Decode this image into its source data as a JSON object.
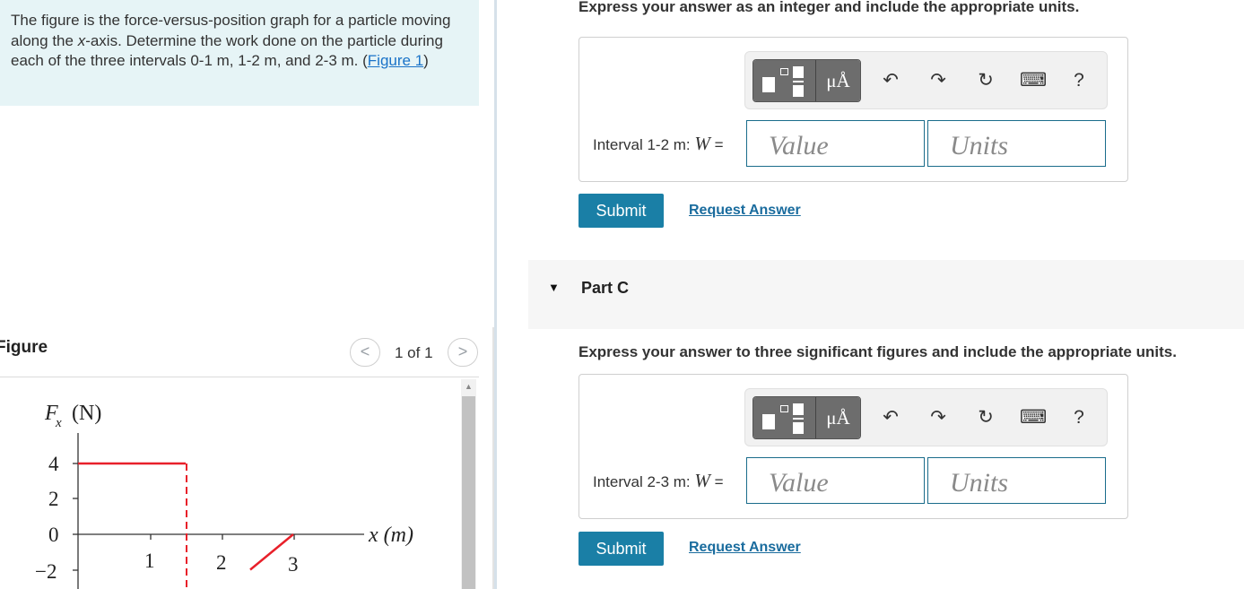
{
  "problem": {
    "text_before": "The figure is the force-versus-position graph for a particle moving along the ",
    "xvar": "x",
    "text_after": "-axis. Determine the work done on the particle during each of the three intervals 0-1 m, 1-2 m, and 2-3 m. (",
    "figure_link": "Figure 1",
    "text_close": ")"
  },
  "figure": {
    "title": "Figure",
    "prev": "<",
    "next": ">",
    "count": "1 of 1"
  },
  "graph": {
    "ylabel_f": "F",
    "ylabel_sub": "x",
    "ylabel_unit": "(N)",
    "xlabel": "x (m)",
    "y_ticks": [
      "4",
      "2",
      "0",
      "−2"
    ],
    "x_ticks": [
      "1",
      "2",
      "3"
    ]
  },
  "chart_data": {
    "type": "line",
    "title": "",
    "xlabel": "x (m)",
    "ylabel": "Fx (N)",
    "x_ticks": [
      1,
      2,
      3
    ],
    "y_ticks": [
      4,
      2,
      0,
      -2
    ],
    "series": [
      {
        "x": [
          0,
          1.5
        ],
        "y": [
          4,
          4
        ]
      },
      {
        "x": [
          2.4,
          3
        ],
        "y": [
          -2,
          0
        ]
      }
    ]
  },
  "scrollbar": {
    "up": "▲"
  },
  "section_b": {
    "instruction": "Express your answer as an integer and include the appropriate units.",
    "interval_prefix": "Interval 1-2 m: ",
    "wvar": "W",
    "equals": " =",
    "value_placeholder": "Value",
    "units_placeholder": "Units",
    "submit": "Submit",
    "request": "Request Answer"
  },
  "part_c": {
    "caret": "▼",
    "title": "Part C"
  },
  "section_c": {
    "instruction": "Express your answer to three significant figures and include the appropriate units.",
    "interval_prefix": "Interval 2-3 m: ",
    "wvar": "W",
    "equals": " =",
    "value_placeholder": "Value",
    "units_placeholder": "Units",
    "submit": "Submit",
    "request": "Request Answer"
  },
  "toolbar": {
    "units_label": "μÅ",
    "undo": "↶",
    "redo": "↷",
    "reset": "↻",
    "keyboard": "⌨",
    "help": "?"
  },
  "colors": {
    "problem_bg": "#e6f4f6",
    "graph_line": "#e8202a",
    "submit_bg": "#1a7fa6",
    "link": "#1a6c9e"
  }
}
